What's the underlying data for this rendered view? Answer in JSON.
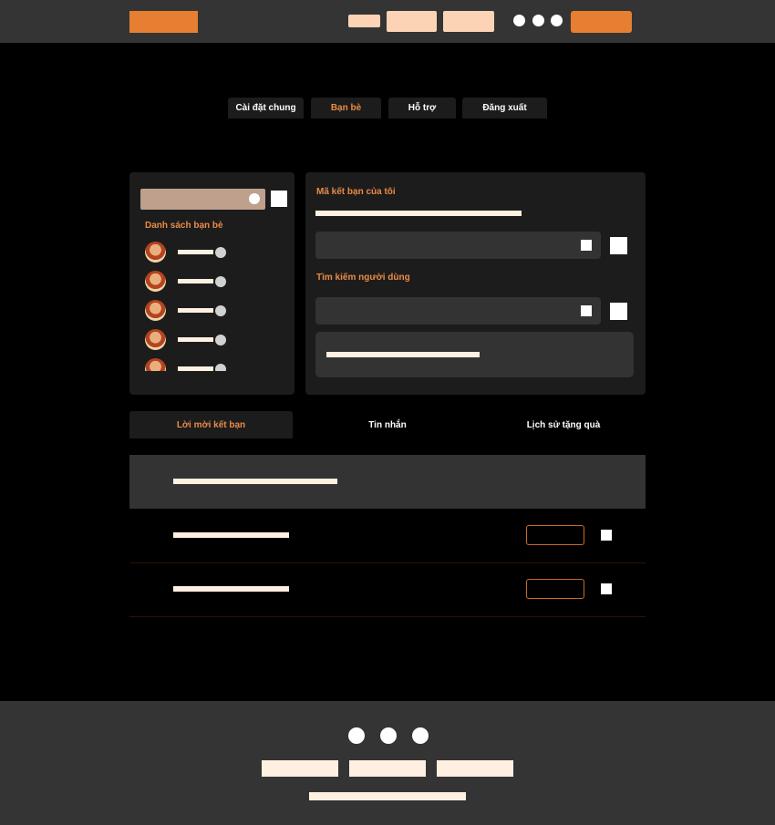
{
  "main_tabs": [
    {
      "label": "Cài đặt chung",
      "active": false
    },
    {
      "label": "Bạn bè",
      "active": true
    },
    {
      "label": "Hỗ trợ",
      "active": false
    },
    {
      "label": "Đăng xuất",
      "active": false
    }
  ],
  "friends_panel": {
    "title": "Danh sách bạn bè",
    "friends_count_visible": 5
  },
  "code_panel": {
    "my_code_title": "Mã kết bạn của tôi",
    "search_title": "Tìm kiếm người dùng"
  },
  "sub_tabs": [
    {
      "label": "Lời mời kết bạn",
      "active": true
    },
    {
      "label": "Tin nhắn",
      "active": false
    },
    {
      "label": "Lịch sử tặng quà",
      "active": false
    }
  ],
  "colors": {
    "accent": "#e67f32",
    "accent_text": "#ea8b47",
    "panel": "#1c1c1c",
    "header_bg": "#343434",
    "placeholder_light": "#fff0e2",
    "nav_pill": "#fdd3b6"
  },
  "icons": [
    "avatar-image",
    "status-dot",
    "copy-icon",
    "search-icon",
    "accept-icon"
  ]
}
